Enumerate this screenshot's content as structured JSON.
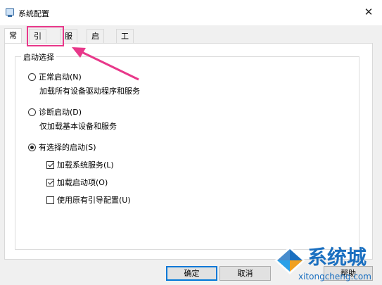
{
  "window": {
    "title": "系统配置",
    "close_glyph": "✕"
  },
  "tabs": [
    {
      "label": "常规",
      "active": true
    },
    {
      "label": "引导",
      "active": false
    },
    {
      "label": "服务",
      "active": false
    },
    {
      "label": "启动",
      "active": false
    },
    {
      "label": "工具",
      "active": false
    }
  ],
  "startup_group": {
    "title": "启动选择",
    "options": [
      {
        "label": "正常启动(N)",
        "desc": "加载所有设备驱动程序和服务",
        "selected": false
      },
      {
        "label": "诊断启动(D)",
        "desc": "仅加载基本设备和服务",
        "selected": false
      },
      {
        "label": "有选择的启动(S)",
        "selected": true
      }
    ],
    "checkboxes": [
      {
        "label": "加载系统服务(L)",
        "checked": true
      },
      {
        "label": "加载启动项(O)",
        "checked": true
      },
      {
        "label": "使用原有引导配置(U)",
        "checked": false
      }
    ]
  },
  "buttons": {
    "ok": "确定",
    "cancel": "取消",
    "help": "帮助"
  },
  "annotation": {
    "color": "#e8388a"
  },
  "watermark": {
    "text": "系统城",
    "url": "xitongcheng.com"
  }
}
